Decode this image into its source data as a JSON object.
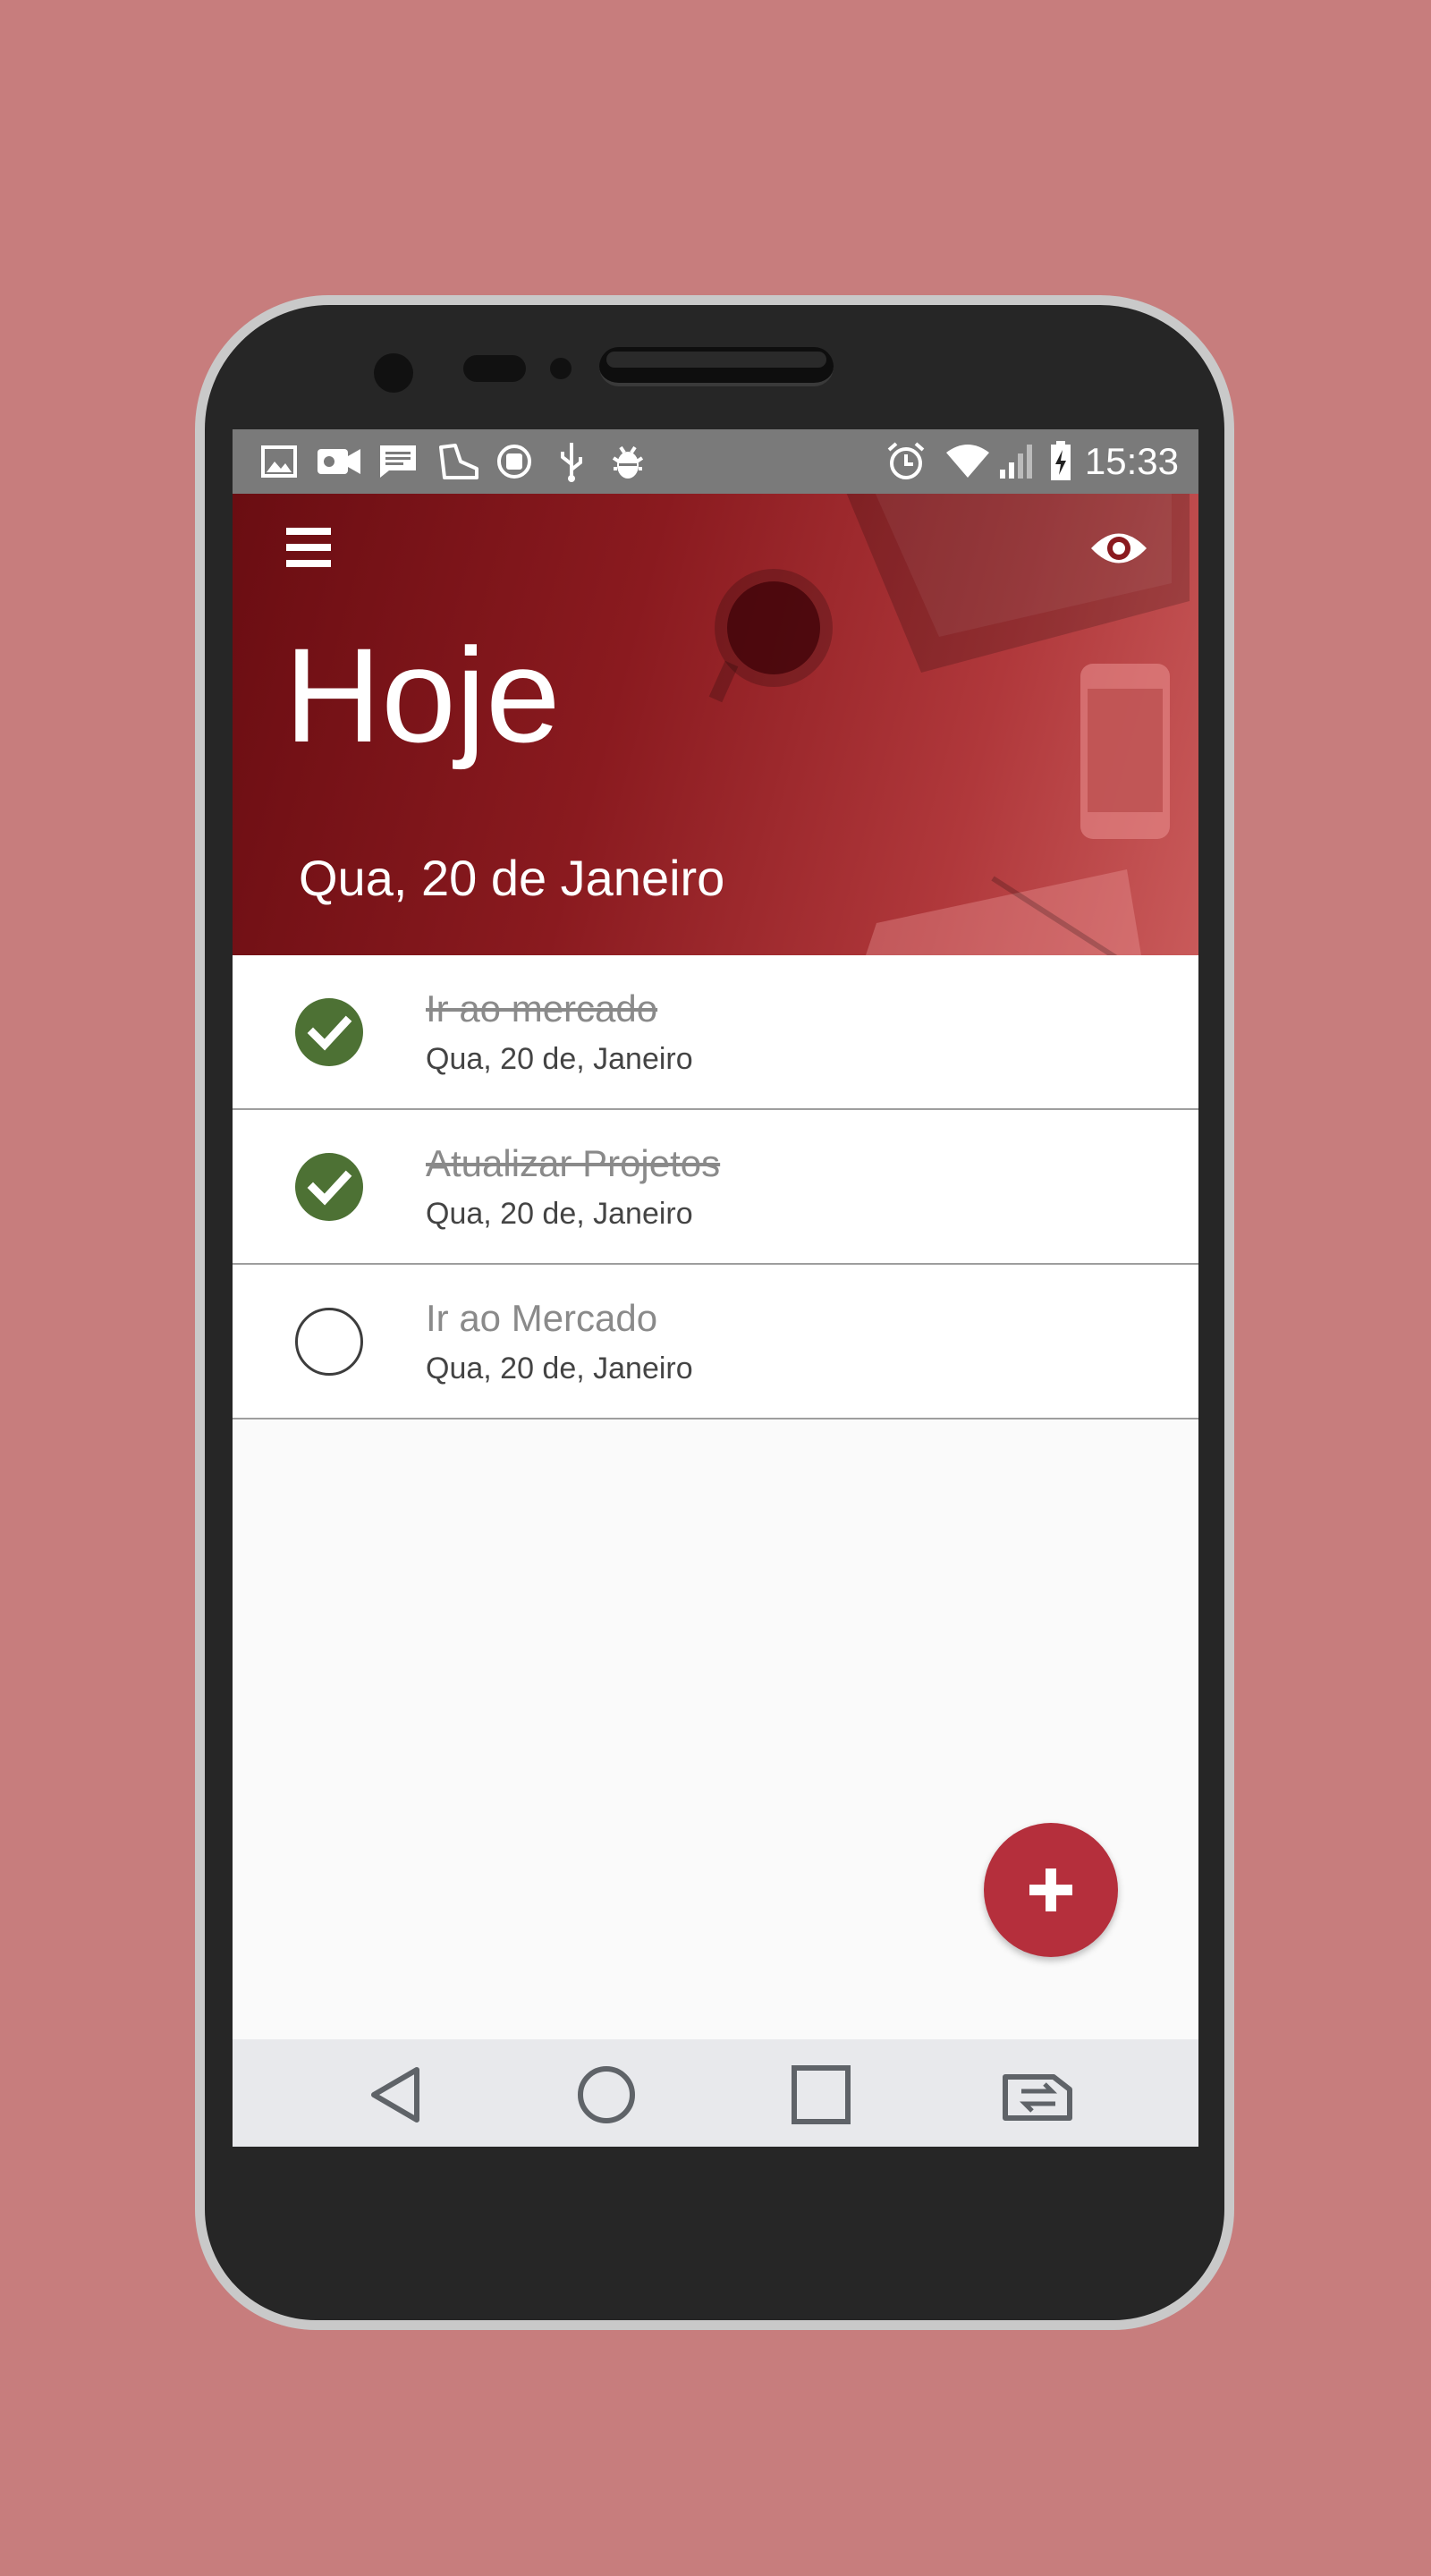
{
  "status_bar": {
    "time": "15:33",
    "left_icons": [
      "image-icon",
      "video-icon",
      "message-icon",
      "shoe-icon",
      "sync-icon",
      "usb-icon",
      "bug-icon"
    ],
    "right_icons": [
      "alarm-icon",
      "wifi-icon",
      "signal-icon",
      "battery-charging-icon"
    ]
  },
  "header": {
    "title": "Hoje",
    "date": "Qua, 20 de Janeiro",
    "menu_icon": "menu-icon",
    "visibility_icon": "eye-icon"
  },
  "tasks": [
    {
      "title": "Ir ao mercado",
      "date": "Qua, 20 de, Janeiro",
      "done": true
    },
    {
      "title": "Atualizar Projetos",
      "date": "Qua, 20 de, Janeiro",
      "done": true
    },
    {
      "title": "Ir ao Mercado",
      "date": "Qua, 20 de, Janeiro",
      "done": false
    }
  ],
  "fab": {
    "icon": "plus-icon"
  },
  "nav_bar": {
    "buttons": [
      "back-icon",
      "home-icon",
      "recents-icon",
      "switch-icon"
    ]
  },
  "colors": {
    "background": "#c77d7d",
    "header_accent": "#8a1a1f",
    "done_check": "#4d7134",
    "fab": "#b52f3c",
    "status_bar": "#7a7a7a"
  }
}
